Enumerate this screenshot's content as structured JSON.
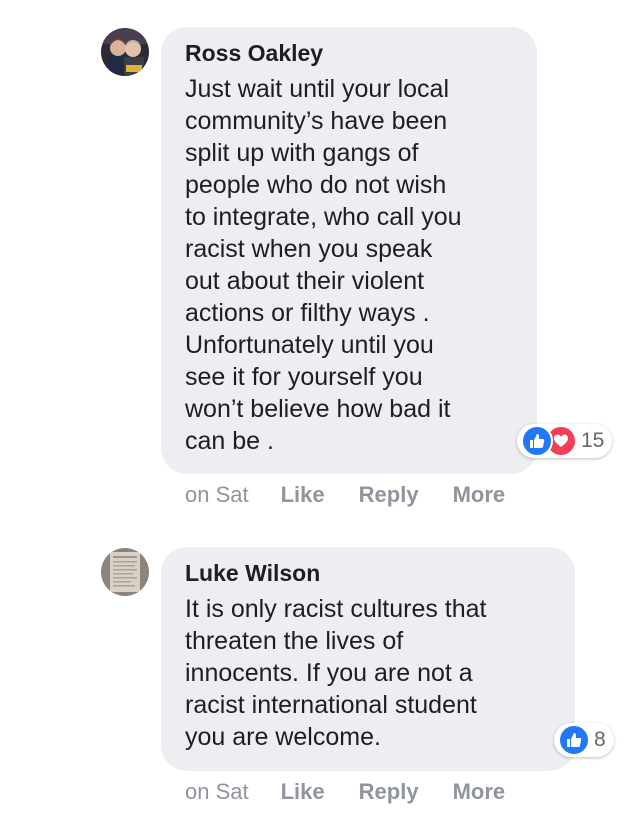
{
  "comments": [
    {
      "author": "Ross Oakley",
      "lines": [
        "Just wait until your local",
        "community’s have been",
        "split up with gangs of",
        "people who do not wish",
        "to integrate, who call you",
        "racist when you speak",
        "out about their violent",
        "actions or filthy ways .",
        "Unfortunately until you",
        "see it for yourself you",
        "won’t believe how bad it",
        "can be ."
      ],
      "reactions": [
        "like-icon",
        "love-icon"
      ],
      "reaction_count": "15",
      "time": "on Sat",
      "like_label": "Like",
      "reply_label": "Reply",
      "more_label": "More"
    },
    {
      "author": "Luke Wilson",
      "lines": [
        "It is only racist cultures that",
        "threaten the lives of",
        "innocents. If you are not a",
        "racist international student",
        "you are welcome."
      ],
      "reactions": [
        "like-icon"
      ],
      "reaction_count": "8",
      "time": "on Sat",
      "like_label": "Like",
      "reply_label": "Reply",
      "more_label": "More"
    }
  ],
  "colors": {
    "bubble": "#eceef1",
    "text": "#1c1e21",
    "meta": "#90949c",
    "like_blue": "#2078f4",
    "love_red": "#f33e58"
  }
}
